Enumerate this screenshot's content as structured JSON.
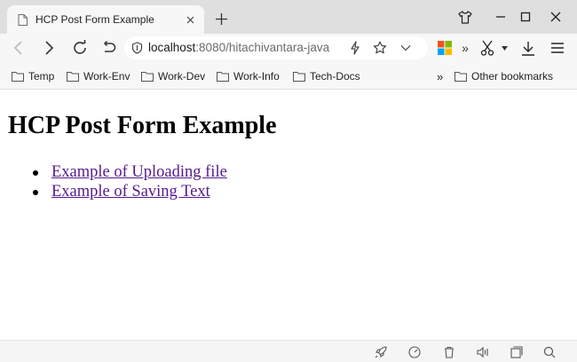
{
  "browser": {
    "tab": {
      "title": "HCP Post Form Example",
      "icon": "document-icon"
    },
    "window_controls": [
      "shirt-icon",
      "minimize-icon",
      "maximize-icon",
      "close-icon"
    ]
  },
  "toolbar": {
    "url_host": "localhost",
    "url_rest": ":8080/hitachivantara-java"
  },
  "bookmarks": {
    "items": [
      {
        "label": "Temp"
      },
      {
        "label": "Work-Env"
      },
      {
        "label": "Work-Dev"
      },
      {
        "label": "Work-Info"
      },
      {
        "label": "Tech-Docs"
      }
    ],
    "overflow": "»",
    "other": "Other bookmarks"
  },
  "page": {
    "heading": "HCP Post Form Example",
    "links": [
      {
        "label": "Example of Uploading file"
      },
      {
        "label": "Example of Saving Text"
      }
    ],
    "link_color": "#551a8b"
  }
}
